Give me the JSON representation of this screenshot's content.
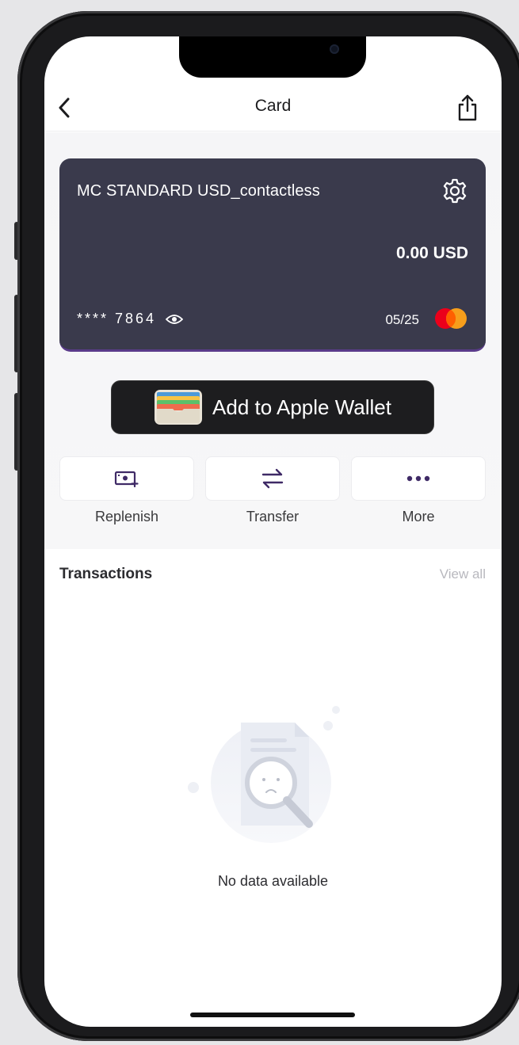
{
  "nav": {
    "title": "Card"
  },
  "card": {
    "name": "MC STANDARD USD_contactless",
    "balance": "0.00 USD",
    "masked_number": "**** 7864",
    "expiry": "05/25",
    "colors": {
      "background": "#3a3a4c",
      "accent": "#5a3b8a",
      "mc_red": "#eb001b",
      "mc_orange": "#f79e1b"
    }
  },
  "wallet": {
    "label": "Add to Apple Wallet"
  },
  "actions": [
    {
      "label": "Replenish",
      "icon": "replenish-icon"
    },
    {
      "label": "Transfer",
      "icon": "transfer-arrows-icon"
    },
    {
      "label": "More",
      "icon": "more-dots-icon"
    }
  ],
  "transactions": {
    "title": "Transactions",
    "view_all": "View all",
    "empty_text": "No data available"
  },
  "theme": {
    "accent": "#4a2d75"
  }
}
